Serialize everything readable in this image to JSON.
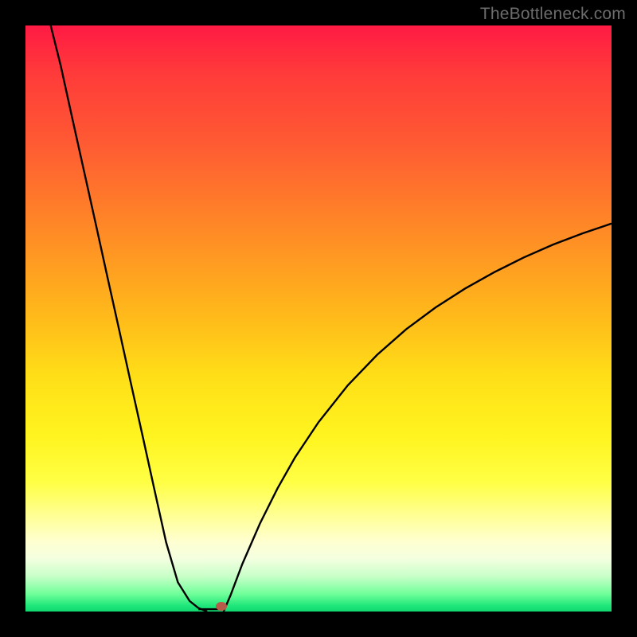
{
  "watermark": "TheBottleneck.com",
  "colors": {
    "background": "#000000",
    "curve": "#000000",
    "marker": "#b85a4a"
  },
  "chart_data": {
    "type": "line",
    "title": "",
    "xlabel": "",
    "ylabel": "",
    "xlim": [
      0,
      100
    ],
    "ylim": [
      0,
      100
    ],
    "legend": false,
    "grid": false,
    "annotations": [
      "TheBottleneck.com"
    ],
    "series": [
      {
        "name": "left-branch",
        "x": [
          4.3,
          6,
          8,
          10,
          12,
          14,
          16,
          18,
          20,
          22,
          24,
          26,
          28,
          29.5,
          30.5,
          31
        ],
        "y": [
          100,
          93.2,
          84.1,
          75.1,
          66.1,
          57.0,
          48.0,
          38.9,
          29.9,
          20.8,
          11.8,
          5.0,
          1.8,
          0.6,
          0.2,
          0
        ]
      },
      {
        "name": "flat-bottom",
        "x": [
          29.5,
          33.8
        ],
        "y": [
          0.4,
          0.4
        ]
      },
      {
        "name": "right-branch",
        "x": [
          33.8,
          35,
          37,
          40,
          43,
          46,
          50,
          55,
          60,
          65,
          70,
          75,
          80,
          85,
          90,
          95,
          100
        ],
        "y": [
          0,
          2.8,
          8.1,
          15.0,
          21.0,
          26.3,
          32.3,
          38.6,
          43.8,
          48.2,
          51.9,
          55.1,
          57.9,
          60.4,
          62.6,
          64.5,
          66.2
        ]
      }
    ],
    "marker": {
      "x": 33.4,
      "y": 0.9
    },
    "background_gradient": {
      "top": "#ff1a44",
      "mid": "#ffdf18",
      "bottom": "#10d770"
    }
  }
}
